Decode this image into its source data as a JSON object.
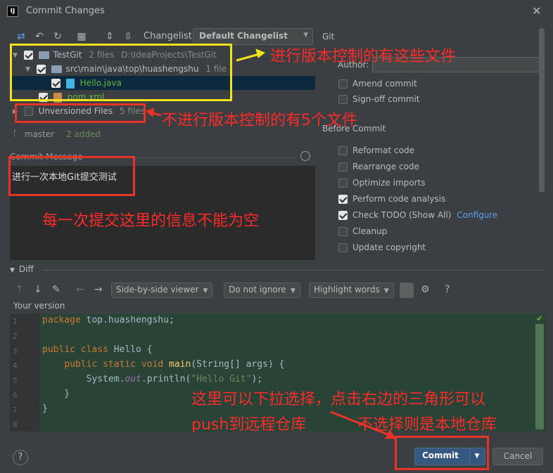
{
  "window": {
    "title": "Commit Changes",
    "app_icon": "IJ"
  },
  "toolbar": {
    "changelist_label": "Changelist:",
    "changelist_value": "Default Changelist"
  },
  "tree": {
    "root": {
      "name": "TestGit",
      "count": "2 files",
      "path": "D:\\IdeaProjects\\TestGit"
    },
    "package": {
      "name": "src\\main\\java\\top\\huashengshu",
      "count": "1 file"
    },
    "file1": "Hello.java",
    "file2": "pom.xml",
    "unversioned": {
      "name": "Unversioned Files",
      "count": "5 files"
    }
  },
  "status": {
    "branch": "master",
    "added": "2 added"
  },
  "commit": {
    "label": "Commit Message",
    "message": "进行一次本地Git提交测试"
  },
  "git": {
    "title": "Git",
    "author_label": "Author:",
    "amend": "Amend commit",
    "signoff": "Sign-off commit",
    "before_commit": "Before Commit",
    "options": [
      {
        "label": "Reformat code",
        "checked": false
      },
      {
        "label": "Rearrange code",
        "checked": false
      },
      {
        "label": "Optimize imports",
        "checked": false
      },
      {
        "label": "Perform code analysis",
        "checked": true
      },
      {
        "label": "Check TODO (Show All)",
        "checked": true
      },
      {
        "label": "Cleanup",
        "checked": false
      },
      {
        "label": "Update copyright",
        "checked": false
      }
    ],
    "configure": "Configure"
  },
  "diff": {
    "title": "Diff",
    "viewer": "Side-by-side viewer",
    "ignore": "Do not ignore",
    "highlight": "Highlight words",
    "help": "?",
    "your_version": "Your version",
    "code": {
      "l1_kw": "package",
      "l1_rest": " top.huashengshu;",
      "l3_kw": "public class",
      "l3_rest": " Hello {",
      "l4_kw": "    public static void",
      "l4_fn": " main",
      "l4_rest": "(String[] args) {",
      "l5_pre": "        System.",
      "l5_it": "out",
      "l5_mid": ".println(",
      "l5_str": "\"Hello Git\"",
      "l5_end": ");",
      "l6": "    }",
      "l7": "}"
    },
    "line_numbers": [
      "1",
      "2",
      "3",
      "4",
      "5",
      "6",
      "7",
      "8"
    ]
  },
  "buttons": {
    "help": "?",
    "commit": "Commit",
    "cancel": "Cancel"
  },
  "annotations": {
    "a1": "进行版本控制的有这些文件",
    "a2": "不进行版本控制的有5个文件",
    "a3": "每一次提交这里的信息不能为空",
    "a4": "这里可以下拉选择，点击右边的三角形可以",
    "a5": "push到远程仓库",
    "a6": "不选择则是本地仓库"
  },
  "colors": {
    "background": "#3c3f41",
    "accent": "#365880",
    "annotation_red": "#e8322a",
    "annotation_yellow": "#f2e21c"
  }
}
